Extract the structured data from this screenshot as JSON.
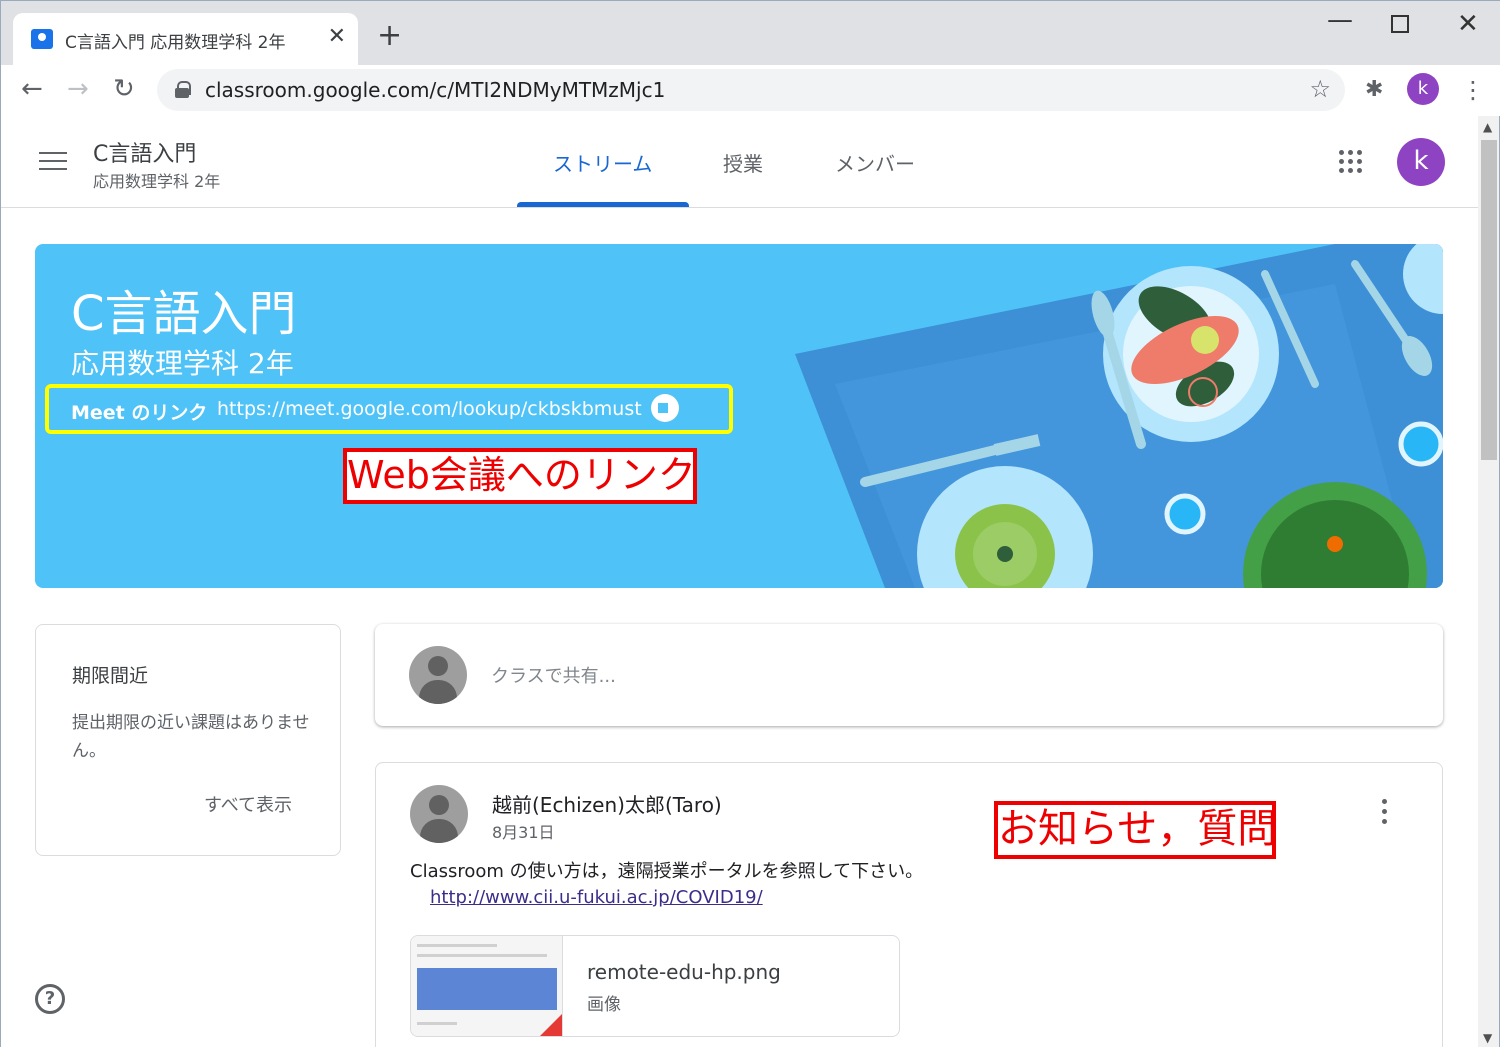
{
  "browser": {
    "tab_title": "C言語入門 応用数理学科 2年",
    "tab_close": "✕",
    "new_tab": "+",
    "url": "classroom.google.com/c/MTI2NDMyMTMzMjc1",
    "profile_initial": "k",
    "icons": {
      "back": "arrow-left-icon",
      "forward": "arrow-right-icon",
      "reload": "reload-icon",
      "lock": "lock-icon",
      "star": "star-icon",
      "extensions": "puzzle-icon",
      "menu": "kebab-icon"
    }
  },
  "appbar": {
    "class_name": "C言語入門",
    "class_section": "応用数理学科 2年",
    "tabs": [
      {
        "label": "ストリーム",
        "active": true
      },
      {
        "label": "授業",
        "active": false
      },
      {
        "label": "メンバー",
        "active": false
      }
    ],
    "avatar_initial": "k",
    "accent_color": "#1967d2",
    "avatar_color": "#8e44c2"
  },
  "banner": {
    "title": "C言語入門",
    "subtitle": "応用数理学科 2年",
    "meet_label": "Meet のリンク",
    "meet_url": "https://meet.google.com/lookup/ckbskbmust",
    "background_color": "#4fc3f7"
  },
  "annotations": {
    "web_meeting": "Web会議へのリンク",
    "notice": "お知らせ，質問",
    "color": "#ee0000"
  },
  "upcoming": {
    "title": "期限間近",
    "message": "提出期限の近い課題はありません。",
    "view_all": "すべて表示"
  },
  "share": {
    "placeholder": "クラスで共有..."
  },
  "post": {
    "author": "越前(Echizen)太郎(Taro)",
    "date": "8月31日",
    "text": "Classroom の使い方は，遠隔授業ポータルを参照して下さい。",
    "link": "http://www.cii.u-fukui.ac.jp/COVID19/",
    "attachment": {
      "name": "remote-edu-hp.png",
      "type": "画像"
    }
  }
}
